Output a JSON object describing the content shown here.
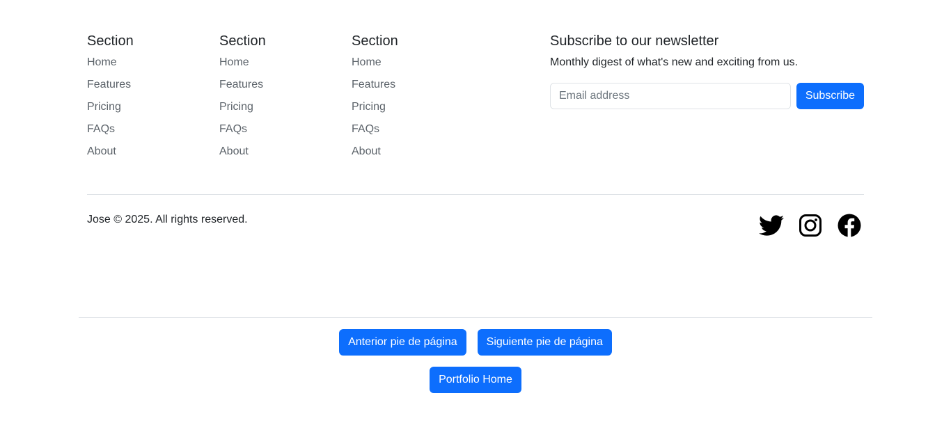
{
  "footer": {
    "sections": [
      {
        "title": "Section",
        "links": [
          "Home",
          "Features",
          "Pricing",
          "FAQs",
          "About"
        ]
      },
      {
        "title": "Section",
        "links": [
          "Home",
          "Features",
          "Pricing",
          "FAQs",
          "About"
        ]
      },
      {
        "title": "Section",
        "links": [
          "Home",
          "Features",
          "Pricing",
          "FAQs",
          "About"
        ]
      }
    ],
    "newsletter": {
      "title": "Subscribe to our newsletter",
      "description": "Monthly digest of what's new and exciting from us.",
      "email_placeholder": "Email address",
      "subscribe_label": "Subscribe"
    },
    "copyright": "Jose © 2025. All rights reserved.",
    "social_icons": [
      "twitter-icon",
      "instagram-icon",
      "facebook-icon"
    ]
  },
  "navigation": {
    "prev_label": "Anterior pie de página",
    "next_label": "Siguiente pie de página",
    "home_label": "Portfolio Home"
  },
  "colors": {
    "primary": "#0d6efd",
    "link": "#6c757d",
    "text": "#212529",
    "border": "#dee2e6"
  }
}
